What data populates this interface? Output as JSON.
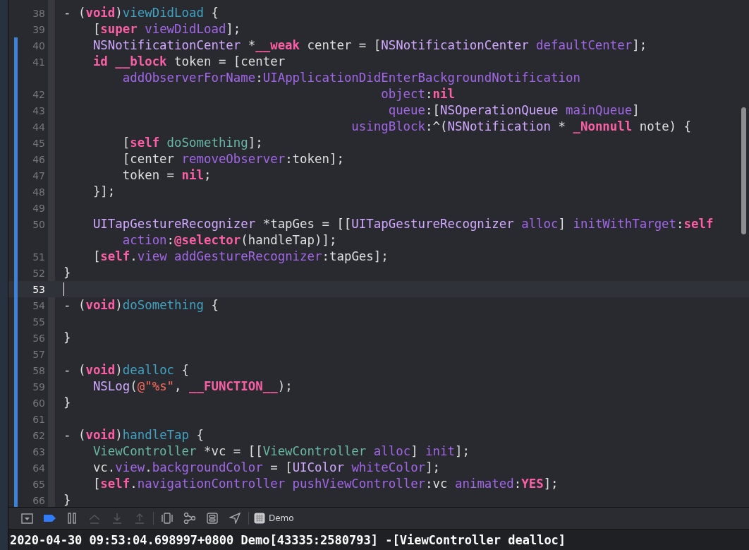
{
  "editor": {
    "lines": [
      {
        "number": "38",
        "changed": false,
        "selected": false,
        "rows": [
          {
            "spans": [
              {
                "text": "- (",
                "kind": "plain"
              },
              {
                "text": "void",
                "kind": "keyword"
              },
              {
                "text": ")",
                "kind": "plain"
              },
              {
                "text": "viewDidLoad",
                "kind": "decl"
              },
              {
                "text": " {",
                "kind": "plain"
              }
            ]
          }
        ]
      },
      {
        "number": "39",
        "changed": false,
        "selected": false,
        "rows": [
          {
            "spans": [
              {
                "text": "    [",
                "kind": "plain"
              },
              {
                "text": "super",
                "kind": "keyword"
              },
              {
                "text": " viewDidLoad",
                "kind": "method"
              },
              {
                "text": "];",
                "kind": "plain"
              }
            ]
          }
        ]
      },
      {
        "number": "40",
        "changed": true,
        "selected": false,
        "rows": [
          {
            "spans": [
              {
                "text": "    NSNotificationCenter",
                "kind": "type"
              },
              {
                "text": " *",
                "kind": "plain"
              },
              {
                "text": "__weak",
                "kind": "keyword"
              },
              {
                "text": " center = [",
                "kind": "plain"
              },
              {
                "text": "NSNotificationCenter",
                "kind": "type"
              },
              {
                "text": " defaultCenter",
                "kind": "method"
              },
              {
                "text": "];",
                "kind": "plain"
              }
            ]
          }
        ]
      },
      {
        "number": "41",
        "changed": true,
        "selected": false,
        "rows": [
          {
            "spans": [
              {
                "text": "    id",
                "kind": "keyword"
              },
              {
                "text": " __block",
                "kind": "keyword"
              },
              {
                "text": " token = [center",
                "kind": "plain"
              }
            ]
          },
          {
            "spans": [
              {
                "text": "        addObserverForName",
                "kind": "method"
              },
              {
                "text": ":",
                "kind": "plain"
              },
              {
                "text": "UIApplicationDidEnterBackgroundNotification",
                "kind": "method"
              }
            ]
          }
        ]
      },
      {
        "number": "42",
        "changed": true,
        "selected": false,
        "rows": [
          {
            "spans": [
              {
                "text": "                                           object",
                "kind": "method"
              },
              {
                "text": ":",
                "kind": "plain"
              },
              {
                "text": "nil",
                "kind": "keyword"
              }
            ]
          }
        ]
      },
      {
        "number": "43",
        "changed": true,
        "selected": false,
        "rows": [
          {
            "spans": [
              {
                "text": "                                            queue",
                "kind": "method"
              },
              {
                "text": ":[",
                "kind": "plain"
              },
              {
                "text": "NSOperationQueue",
                "kind": "type"
              },
              {
                "text": " mainQueue",
                "kind": "method"
              },
              {
                "text": "]",
                "kind": "plain"
              }
            ]
          }
        ]
      },
      {
        "number": "44",
        "changed": true,
        "selected": false,
        "rows": [
          {
            "spans": [
              {
                "text": "                                       usingBlock",
                "kind": "method"
              },
              {
                "text": ":^(",
                "kind": "plain"
              },
              {
                "text": "NSNotification",
                "kind": "type"
              },
              {
                "text": " * ",
                "kind": "plain"
              },
              {
                "text": "_Nonnull",
                "kind": "keyword"
              },
              {
                "text": " note) {",
                "kind": "plain"
              }
            ]
          }
        ]
      },
      {
        "number": "45",
        "changed": true,
        "selected": false,
        "rows": [
          {
            "spans": [
              {
                "text": "        [",
                "kind": "plain"
              },
              {
                "text": "self",
                "kind": "keyword"
              },
              {
                "text": " doSomething",
                "kind": "project"
              },
              {
                "text": "];",
                "kind": "plain"
              }
            ]
          }
        ]
      },
      {
        "number": "46",
        "changed": true,
        "selected": false,
        "rows": [
          {
            "spans": [
              {
                "text": "        [center ",
                "kind": "plain"
              },
              {
                "text": "removeObserver",
                "kind": "method"
              },
              {
                "text": ":token];",
                "kind": "plain"
              }
            ]
          }
        ]
      },
      {
        "number": "47",
        "changed": true,
        "selected": false,
        "rows": [
          {
            "spans": [
              {
                "text": "        token = ",
                "kind": "plain"
              },
              {
                "text": "nil",
                "kind": "keyword"
              },
              {
                "text": ";",
                "kind": "plain"
              }
            ]
          }
        ]
      },
      {
        "number": "48",
        "changed": true,
        "selected": false,
        "rows": [
          {
            "spans": [
              {
                "text": "    }];",
                "kind": "plain"
              }
            ]
          }
        ]
      },
      {
        "number": "49",
        "changed": true,
        "selected": false
      },
      {
        "number": "50",
        "changed": true,
        "selected": false,
        "rows": [
          {
            "spans": [
              {
                "text": "    UITapGestureRecognizer",
                "kind": "type"
              },
              {
                "text": " *tapGes = [[",
                "kind": "plain"
              },
              {
                "text": "UITapGestureRecognizer",
                "kind": "type"
              },
              {
                "text": " alloc",
                "kind": "method"
              },
              {
                "text": "] ",
                "kind": "plain"
              },
              {
                "text": "initWithTarget",
                "kind": "method"
              },
              {
                "text": ":",
                "kind": "plain"
              },
              {
                "text": "self",
                "kind": "keyword"
              }
            ]
          },
          {
            "spans": [
              {
                "text": "        action",
                "kind": "method"
              },
              {
                "text": ":",
                "kind": "plain"
              },
              {
                "text": "@selector",
                "kind": "keyword"
              },
              {
                "text": "(handleTap)];",
                "kind": "plain"
              }
            ]
          }
        ]
      },
      {
        "number": "51",
        "changed": true,
        "selected": false,
        "rows": [
          {
            "spans": [
              {
                "text": "    [",
                "kind": "plain"
              },
              {
                "text": "self",
                "kind": "keyword"
              },
              {
                "text": ".",
                "kind": "plain"
              },
              {
                "text": "view",
                "kind": "method"
              },
              {
                "text": " addGestureRecognizer",
                "kind": "method"
              },
              {
                "text": ":tapGes];",
                "kind": "plain"
              }
            ]
          }
        ]
      },
      {
        "number": "52",
        "changed": true,
        "selected": false,
        "rows": [
          {
            "spans": [
              {
                "text": "}",
                "kind": "plain"
              }
            ]
          }
        ]
      },
      {
        "number": "53",
        "changed": true,
        "selected": true
      },
      {
        "number": "54",
        "changed": true,
        "selected": false,
        "rows": [
          {
            "spans": [
              {
                "text": "- (",
                "kind": "plain"
              },
              {
                "text": "void",
                "kind": "keyword"
              },
              {
                "text": ")",
                "kind": "plain"
              },
              {
                "text": "doSomething",
                "kind": "decl"
              },
              {
                "text": " {",
                "kind": "plain"
              }
            ]
          }
        ]
      },
      {
        "number": "55",
        "changed": true,
        "selected": false
      },
      {
        "number": "56",
        "changed": true,
        "selected": false,
        "rows": [
          {
            "spans": [
              {
                "text": "}",
                "kind": "plain"
              }
            ]
          }
        ]
      },
      {
        "number": "57",
        "changed": true,
        "selected": false
      },
      {
        "number": "58",
        "changed": true,
        "selected": false,
        "rows": [
          {
            "spans": [
              {
                "text": "- (",
                "kind": "plain"
              },
              {
                "text": "void",
                "kind": "keyword"
              },
              {
                "text": ")",
                "kind": "plain"
              },
              {
                "text": "dealloc",
                "kind": "decl"
              },
              {
                "text": " {",
                "kind": "plain"
              }
            ]
          }
        ]
      },
      {
        "number": "59",
        "changed": true,
        "selected": false,
        "rows": [
          {
            "spans": [
              {
                "text": "    NSLog",
                "kind": "type"
              },
              {
                "text": "(",
                "kind": "plain"
              },
              {
                "text": "@\"%s\"",
                "kind": "string"
              },
              {
                "text": ", ",
                "kind": "plain"
              },
              {
                "text": "__FUNCTION__",
                "kind": "keyword"
              },
              {
                "text": ");",
                "kind": "plain"
              }
            ]
          }
        ]
      },
      {
        "number": "60",
        "changed": true,
        "selected": false,
        "rows": [
          {
            "spans": [
              {
                "text": "}",
                "kind": "plain"
              }
            ]
          }
        ]
      },
      {
        "number": "61",
        "changed": true,
        "selected": false
      },
      {
        "number": "62",
        "changed": true,
        "selected": false,
        "rows": [
          {
            "spans": [
              {
                "text": "- (",
                "kind": "plain"
              },
              {
                "text": "void",
                "kind": "keyword"
              },
              {
                "text": ")",
                "kind": "plain"
              },
              {
                "text": "handleTap",
                "kind": "decl"
              },
              {
                "text": " {",
                "kind": "plain"
              }
            ]
          }
        ]
      },
      {
        "number": "63",
        "changed": true,
        "selected": false,
        "rows": [
          {
            "spans": [
              {
                "text": "    ViewController",
                "kind": "project"
              },
              {
                "text": " *vc = [[",
                "kind": "plain"
              },
              {
                "text": "ViewController",
                "kind": "project"
              },
              {
                "text": " alloc",
                "kind": "method"
              },
              {
                "text": "] ",
                "kind": "plain"
              },
              {
                "text": "init",
                "kind": "method"
              },
              {
                "text": "];",
                "kind": "plain"
              }
            ]
          }
        ]
      },
      {
        "number": "64",
        "changed": true,
        "selected": false,
        "rows": [
          {
            "spans": [
              {
                "text": "    vc.",
                "kind": "plain"
              },
              {
                "text": "view",
                "kind": "method"
              },
              {
                "text": ".",
                "kind": "plain"
              },
              {
                "text": "backgroundColor",
                "kind": "method"
              },
              {
                "text": " = [",
                "kind": "plain"
              },
              {
                "text": "UIColor",
                "kind": "type"
              },
              {
                "text": " whiteColor",
                "kind": "method"
              },
              {
                "text": "];",
                "kind": "plain"
              }
            ]
          }
        ]
      },
      {
        "number": "65",
        "changed": true,
        "selected": false,
        "rows": [
          {
            "spans": [
              {
                "text": "    [",
                "kind": "plain"
              },
              {
                "text": "self",
                "kind": "keyword"
              },
              {
                "text": ".",
                "kind": "plain"
              },
              {
                "text": "navigationController",
                "kind": "method"
              },
              {
                "text": " pushViewController",
                "kind": "method"
              },
              {
                "text": ":vc ",
                "kind": "plain"
              },
              {
                "text": "animated",
                "kind": "method"
              },
              {
                "text": ":",
                "kind": "plain"
              },
              {
                "text": "YES",
                "kind": "keyword"
              },
              {
                "text": "];",
                "kind": "plain"
              }
            ]
          }
        ]
      },
      {
        "number": "66",
        "changed": true,
        "selected": false,
        "rows": [
          {
            "spans": [
              {
                "text": "}",
                "kind": "plain"
              }
            ]
          }
        ]
      }
    ]
  },
  "debug_bar": {
    "items": [
      {
        "kind": "hide-debug-area",
        "disabled": false
      },
      {
        "kind": "breakpoints",
        "disabled": false,
        "on": true
      },
      {
        "kind": "pause",
        "disabled": false
      },
      {
        "kind": "step-over",
        "disabled": true
      },
      {
        "kind": "step-into",
        "disabled": true
      },
      {
        "kind": "step-out",
        "disabled": true
      },
      {
        "kind": "divider"
      },
      {
        "kind": "view-debugger",
        "disabled": false
      },
      {
        "kind": "memory-graph",
        "disabled": false
      },
      {
        "kind": "environment",
        "disabled": false
      },
      {
        "kind": "location",
        "disabled": false
      },
      {
        "kind": "divider"
      }
    ],
    "target": {
      "label": "Demo"
    }
  },
  "console": {
    "text": "2020-04-30 09:53:04.698997+0800 Demo[43335:2580793] -[ViewController dealloc]"
  }
}
